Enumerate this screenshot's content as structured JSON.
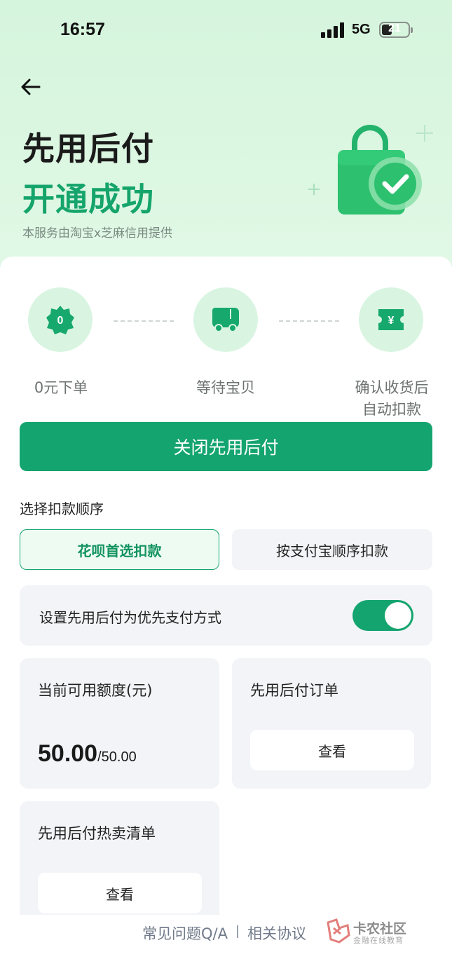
{
  "status_bar": {
    "time": "16:57",
    "network": "5G",
    "battery": "21"
  },
  "header": {
    "title": "先用后付",
    "subtitle": "开通成功",
    "note": "本服务由淘宝x芝麻信用提供"
  },
  "steps": [
    {
      "icon": "zero-badge-icon",
      "badge_text": "0",
      "label": "0元下单"
    },
    {
      "icon": "truck-icon",
      "label": "等待宝贝"
    },
    {
      "icon": "yuan-ticket-icon",
      "badge_text": "¥",
      "label_line1": "确认收货后",
      "label_line2": "自动扣款"
    }
  ],
  "close_button_label": "关闭先用后付",
  "deduction": {
    "section_label": "选择扣款顺序",
    "options": [
      {
        "label": "花呗首选扣款",
        "selected": true
      },
      {
        "label": "按支付宝顺序扣款",
        "selected": false
      }
    ]
  },
  "preference": {
    "label": "设置先用后付为优先支付方式",
    "enabled": true
  },
  "tiles": {
    "quota": {
      "title": "当前可用额度(元)",
      "value": "50.00",
      "total": "/50.00"
    },
    "orders": {
      "title": "先用后付订单",
      "button": "查看"
    },
    "hot_list": {
      "title": "先用后付热卖清单",
      "button": "查看"
    }
  },
  "footer": {
    "faq": "常见问题Q/A",
    "agreement": "相关协议"
  },
  "watermark": {
    "name": "卡农社区",
    "sub": "金融在线教育"
  },
  "colors": {
    "primary": "#14a46f",
    "header_bg": "#d6f5dd",
    "step_circle": "#d9f5e2"
  }
}
